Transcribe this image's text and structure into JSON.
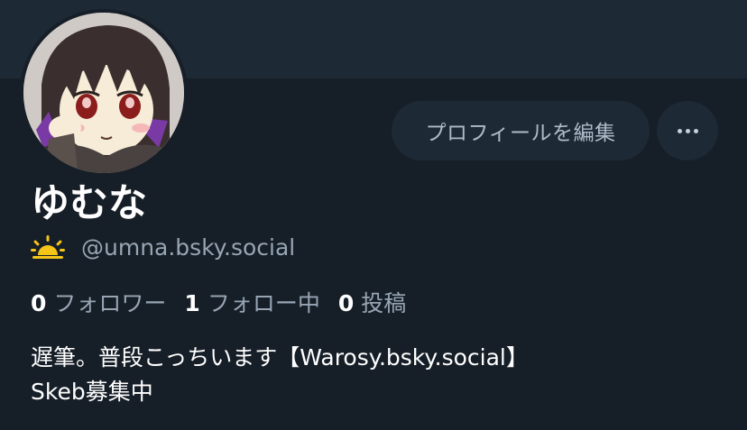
{
  "profile": {
    "display_name": "ゆむな",
    "handle": "@umna.bsky.social",
    "handle_icon": "sun-icon",
    "edit_button_label": "プロフィールを編集",
    "more_icon": "ellipsis-icon"
  },
  "stats": {
    "followers_count": "0",
    "followers_label": "フォロワー",
    "following_count": "1",
    "following_label": "フォロー中",
    "posts_count": "0",
    "posts_label": "投稿"
  },
  "bio": {
    "line1": "遅筆。普段こっちいます【Warosy.bsky.social】",
    "line2": "Skeb募集中"
  },
  "colors": {
    "background": "#161e27",
    "banner": "#1e2936",
    "button_bg": "#1e2936",
    "muted_text": "#97a5b4",
    "sun": "#f5c518"
  }
}
